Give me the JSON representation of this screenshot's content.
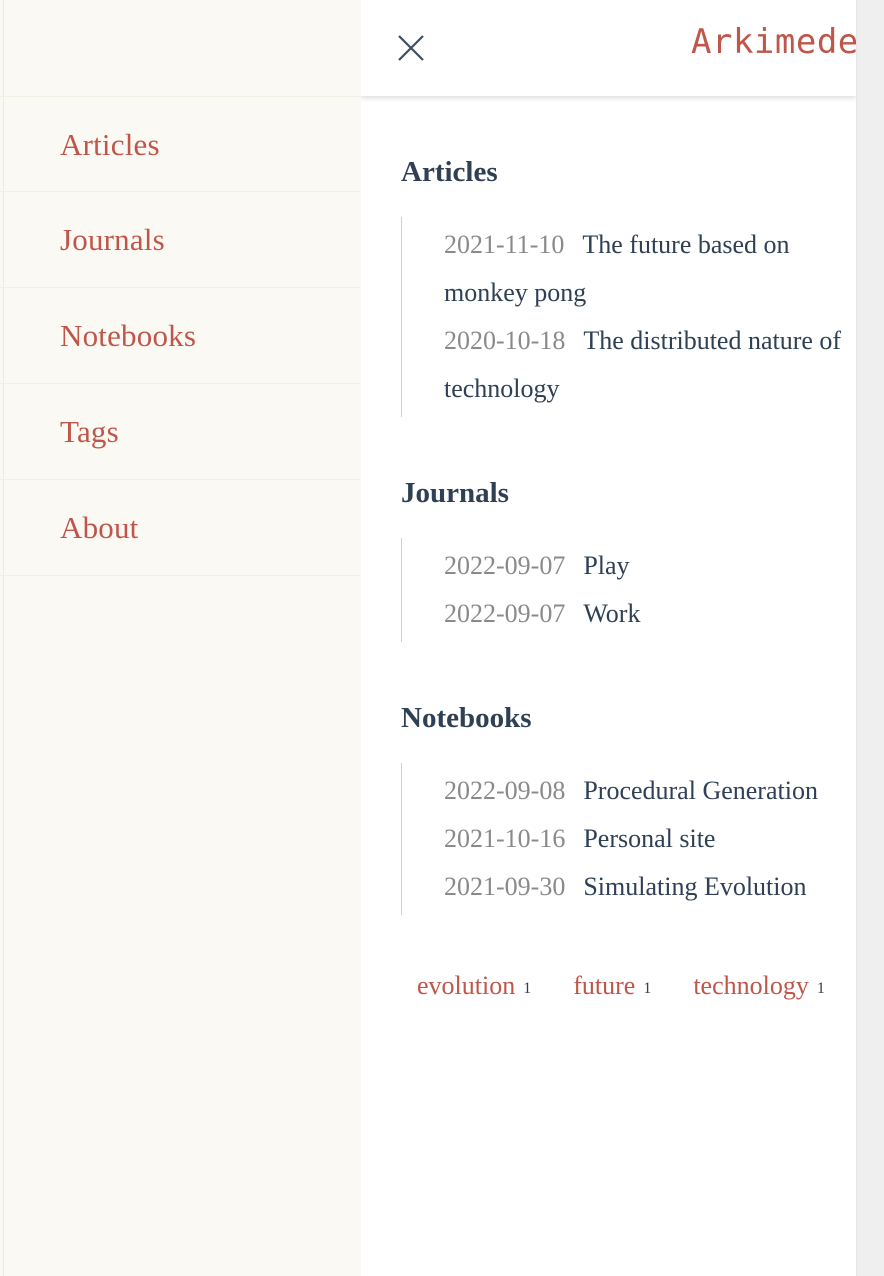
{
  "sidebar": {
    "items": [
      {
        "label": "Articles"
      },
      {
        "label": "Journals"
      },
      {
        "label": "Notebooks"
      },
      {
        "label": "Tags"
      },
      {
        "label": "About"
      }
    ]
  },
  "panel": {
    "close_icon": "close-icon",
    "brand_title": "Arkimedes",
    "sections": [
      {
        "title": "Articles",
        "entries": [
          {
            "date": "2021-11-10",
            "title": "The future based on monkey pong"
          },
          {
            "date": "2020-10-18",
            "title": "The distributed nature of technology"
          }
        ]
      },
      {
        "title": "Journals",
        "entries": [
          {
            "date": "2022-09-07",
            "title": "Play"
          },
          {
            "date": "2022-09-07",
            "title": "Work"
          }
        ]
      },
      {
        "title": "Notebooks",
        "entries": [
          {
            "date": "2022-09-08",
            "title": "Procedural Generation"
          },
          {
            "date": "2021-10-16",
            "title": "Personal site"
          },
          {
            "date": "2021-09-30",
            "title": "Simulating Evolution"
          }
        ]
      }
    ],
    "tags": [
      {
        "name": "evolution",
        "count": "1"
      },
      {
        "name": "future",
        "count": "1"
      },
      {
        "name": "technology",
        "count": "1"
      }
    ]
  },
  "colors": {
    "accent_red": "#c0564a",
    "heading_slate": "#2f4055",
    "date_gray": "#8a8a8a",
    "sidebar_bg": "#faf9f3",
    "panel_bg": "#ffffff"
  }
}
